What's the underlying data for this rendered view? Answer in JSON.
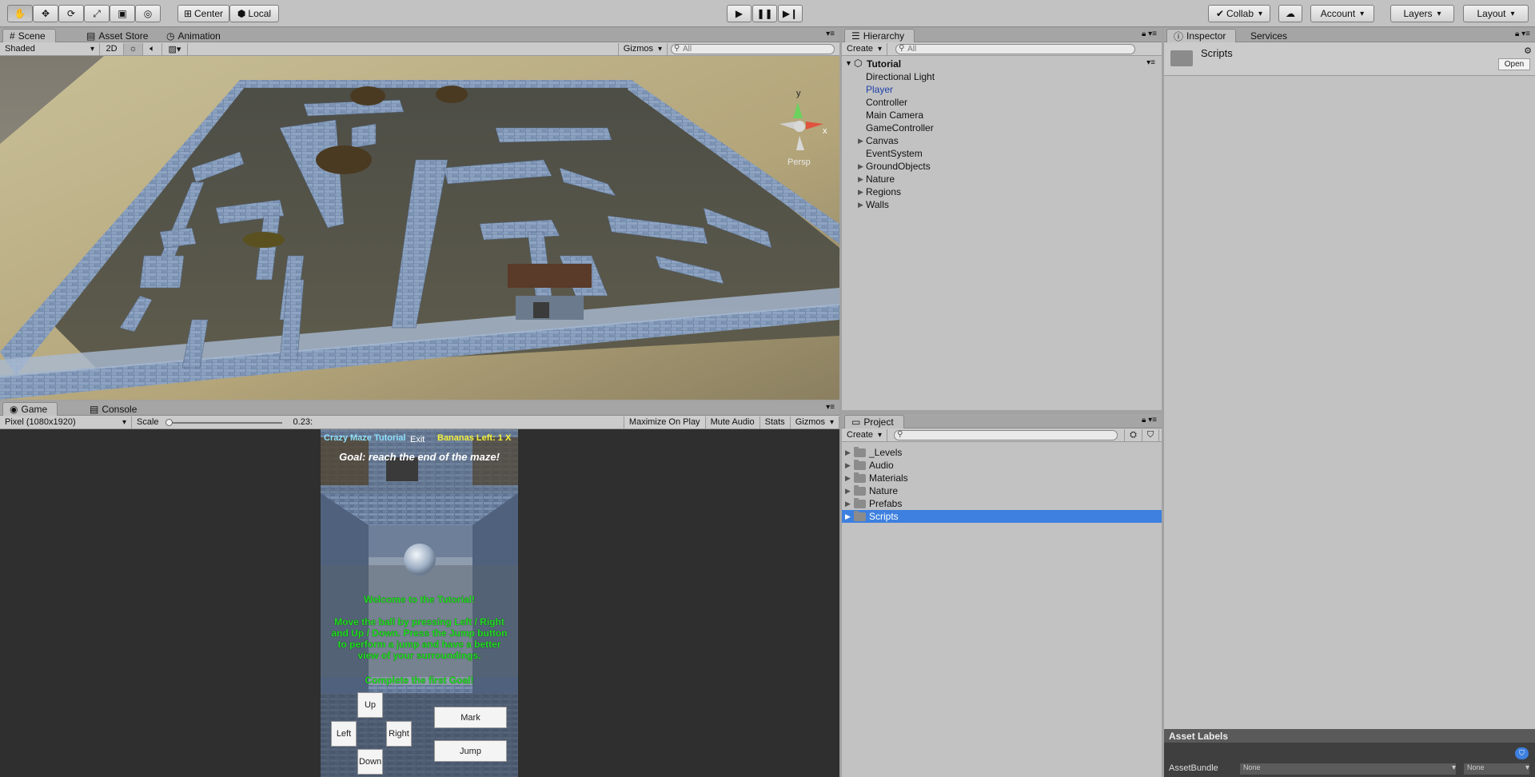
{
  "toolbar": {
    "tools": [
      "hand-tool",
      "move-tool",
      "rotate-tool",
      "scale-tool",
      "rect-tool",
      "transform-tool"
    ],
    "pivot_center": "Center",
    "pivot_local": "Local",
    "collab": "Collab",
    "account": "Account",
    "layers": "Layers",
    "layout": "Layout"
  },
  "scene": {
    "tabs": [
      "Scene",
      "Asset Store",
      "Animation"
    ],
    "shading": "Shaded",
    "mode_2d": "2D",
    "gizmos": "Gizmos",
    "search_placeholder": "All",
    "persp_label": "Persp",
    "axis_y": "y",
    "axis_x": "x"
  },
  "game": {
    "tabs": [
      "Game",
      "Console"
    ],
    "resolution": "Pixel (1080x1920)",
    "scale_label": "Scale",
    "scale_value": "0.23",
    "maximize": "Maximize On Play",
    "mute": "Mute Audio",
    "stats": "Stats",
    "gizmos": "Gizmos",
    "hud": {
      "title": "Crazy Maze Tutorial",
      "exit": "Exit",
      "bananas": "Bananas Left: 1 X",
      "goal": "Goal: reach the end of the maze!",
      "welcome": "Welcome to the Tutorial!",
      "instructions": "Move the ball by pressing Left / Right and Up / Down. Press the Jump button to perform a jump and have a better view of your surroundings.",
      "complete": "Complete the first Goal!",
      "btn_up": "Up",
      "btn_left": "Left",
      "btn_right": "Right",
      "btn_down": "Down",
      "btn_mark": "Mark",
      "btn_jump": "Jump"
    }
  },
  "hierarchy": {
    "tab": "Hierarchy",
    "create": "Create",
    "search_placeholder": "All",
    "scene_name": "Tutorial",
    "items": [
      {
        "label": "Directional Light",
        "expandable": false
      },
      {
        "label": "Player",
        "expandable": false,
        "highlight": true
      },
      {
        "label": "Controller",
        "expandable": false
      },
      {
        "label": "Main Camera",
        "expandable": false
      },
      {
        "label": "GameController",
        "expandable": false
      },
      {
        "label": "Canvas",
        "expandable": true
      },
      {
        "label": "EventSystem",
        "expandable": false
      },
      {
        "label": "GroundObjects",
        "expandable": true
      },
      {
        "label": "Nature",
        "expandable": true
      },
      {
        "label": "Regions",
        "expandable": true
      },
      {
        "label": "Walls",
        "expandable": true
      }
    ]
  },
  "project": {
    "tab": "Project",
    "create": "Create",
    "folders": [
      "_Levels",
      "Audio",
      "Materials",
      "Nature",
      "Prefabs",
      "Scripts"
    ],
    "selected": "Scripts"
  },
  "inspector": {
    "tabs": [
      "Inspector",
      "Services"
    ],
    "asset_name": "Scripts",
    "open_button": "Open",
    "asset_labels": "Asset Labels",
    "asset_bundle_label": "AssetBundle",
    "asset_bundle_value": "None",
    "asset_variant_value": "None"
  },
  "colors": {
    "selection": "#3d80df",
    "highlight_text": "#1d3fa8",
    "hud_green": "#21e021"
  }
}
